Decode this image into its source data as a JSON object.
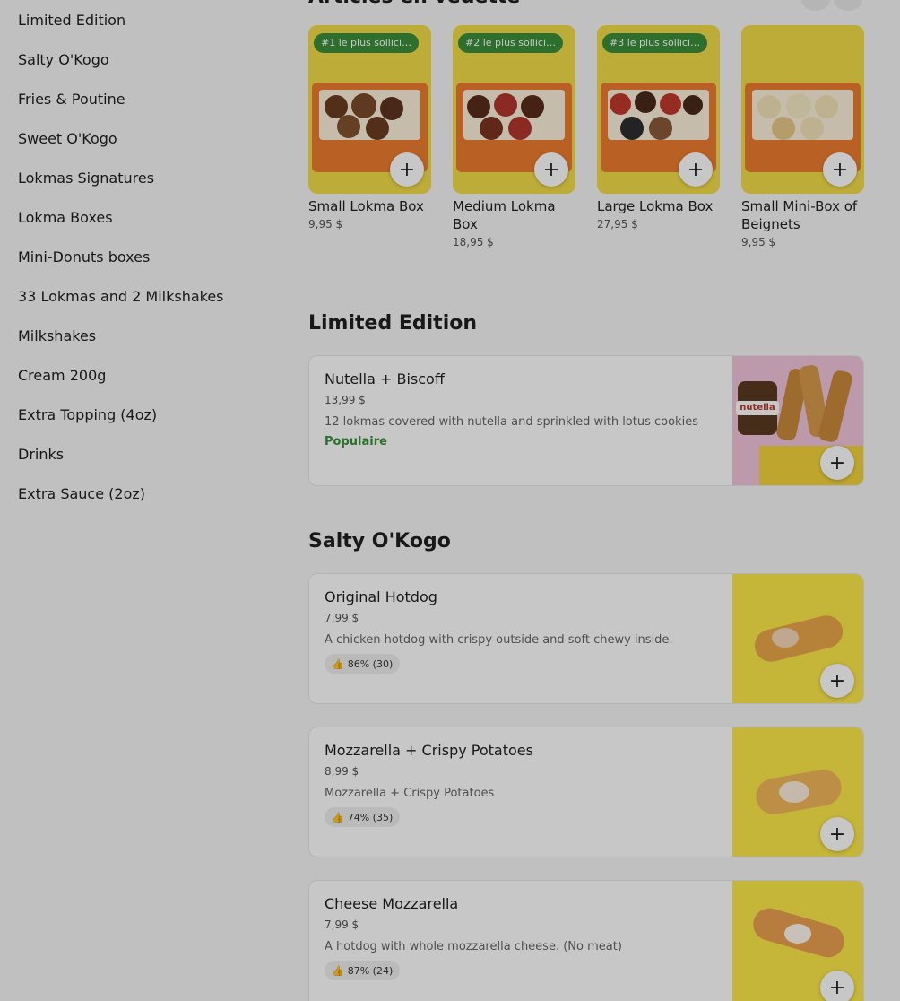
{
  "sidebar": {
    "items": [
      {
        "label": "Limited Edition"
      },
      {
        "label": "Salty O'Kogo"
      },
      {
        "label": "Fries & Poutine"
      },
      {
        "label": "Sweet O'Kogo"
      },
      {
        "label": "Lokmas Signatures"
      },
      {
        "label": "Lokma Boxes"
      },
      {
        "label": "Mini-Donuts boxes"
      },
      {
        "label": "33 Lokmas and 2 Milkshakes"
      },
      {
        "label": "Milkshakes"
      },
      {
        "label": "Cream 200g"
      },
      {
        "label": "Extra Topping (4oz)"
      },
      {
        "label": "Drinks"
      },
      {
        "label": "Extra Sauce (2oz)"
      }
    ]
  },
  "featured": {
    "title": "Articles en vedette",
    "add_icon": "+",
    "items": [
      {
        "badge": "#1 le plus sollici…",
        "name": "Small Lokma Box",
        "price": "9,95 $"
      },
      {
        "badge": "#2 le plus sollici…",
        "name": "Medium Lokma Box",
        "price": "18,95 $"
      },
      {
        "badge": "#3 le plus sollici…",
        "name": "Large Lokma Box",
        "price": "27,95 $"
      },
      {
        "badge": "",
        "name": "Small Mini-Box of Beignets",
        "price": "9,95 $"
      }
    ]
  },
  "sections": [
    {
      "title": "Limited Edition",
      "items": [
        {
          "name": "Nutella + Biscoff",
          "price": "13,99 $",
          "desc": "12 lokmas covered with nutella and sprinkled with lotus cookies",
          "tag": "Populaire",
          "img_text": "nutella"
        }
      ]
    },
    {
      "title": "Salty O'Kogo",
      "items": [
        {
          "name": "Original Hotdog",
          "price": "7,99 $",
          "desc": "A chicken hotdog with crispy outside and soft chewy inside.",
          "rating": "86% (30)"
        },
        {
          "name": "Mozzarella + Crispy Potatoes",
          "price": "8,99 $",
          "desc": "Mozzarella + Crispy Potatoes",
          "rating": "74% (35)"
        },
        {
          "name": "Cheese Mozzarella",
          "price": "7,99 $",
          "desc": "A hotdog with whole mozzarella cheese. (No meat)",
          "rating": "87% (24)"
        }
      ]
    }
  ],
  "colors": {
    "badge_green": "#3c8f3c",
    "popular_green": "#3c8f3c",
    "box_orange": "#ee7d2f",
    "card_yellow": "#f4dd4a"
  },
  "icons": {
    "add": "plus-icon",
    "rating": "thumbs-up-icon"
  }
}
